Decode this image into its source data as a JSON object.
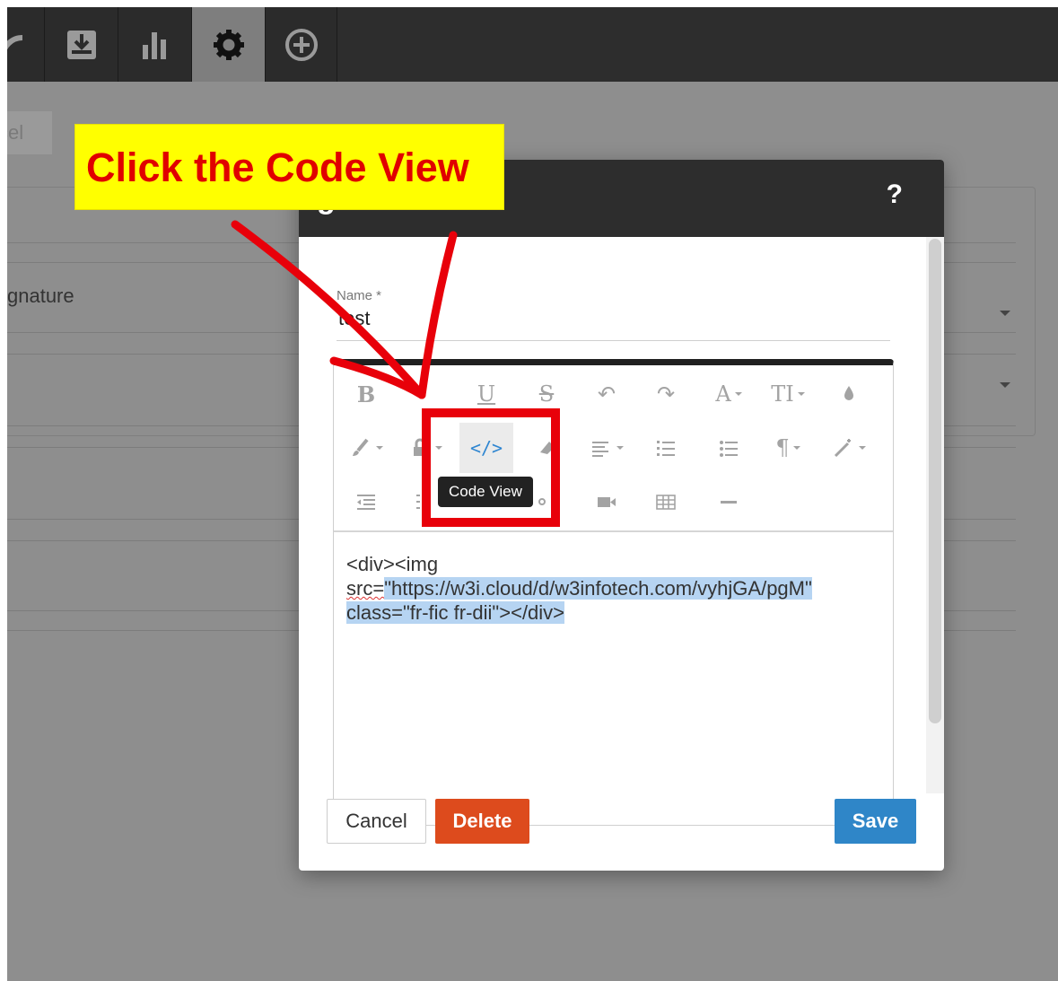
{
  "topbar": {
    "buttons": [
      {
        "icon": "rss-icon",
        "active": false
      },
      {
        "icon": "inbox-download-icon",
        "active": false
      },
      {
        "icon": "bar-chart-icon",
        "active": false
      },
      {
        "icon": "gear-icon",
        "active": true
      },
      {
        "icon": "plus-circle-icon",
        "active": false
      }
    ]
  },
  "background": {
    "button_partial_label": "cel",
    "field_partial_label": "gnature"
  },
  "modal": {
    "title_partial": "g",
    "help_label": "?",
    "name_label": "Name *",
    "name_value": "test",
    "toolbar": {
      "row1": [
        {
          "icon": "bold-icon",
          "glyph": "B"
        },
        {
          "icon": "italic-icon",
          "glyph": ""
        },
        {
          "icon": "underline-icon",
          "glyph": "U"
        },
        {
          "icon": "strikethrough-icon",
          "glyph": "S"
        },
        {
          "icon": "undo-icon",
          "glyph": "↶"
        },
        {
          "icon": "redo-icon",
          "glyph": "↷"
        },
        {
          "icon": "font-family-icon",
          "glyph": "A"
        },
        {
          "icon": "font-size-icon",
          "glyph": "TI"
        },
        {
          "icon": "color-drop-icon",
          "glyph": "💧"
        }
      ],
      "row2": [
        {
          "icon": "paint-brush-icon"
        },
        {
          "icon": "lock-icon"
        },
        {
          "icon": "code-view-icon",
          "glyph": "</>"
        },
        {
          "icon": "eraser-icon"
        },
        {
          "icon": "align-icon"
        },
        {
          "icon": "ordered-list-icon"
        },
        {
          "icon": "unordered-list-icon"
        },
        {
          "icon": "paragraph-icon",
          "glyph": "¶"
        },
        {
          "icon": "magic-wand-icon"
        }
      ],
      "row3": [
        {
          "icon": "outdent-icon"
        },
        {
          "icon": "indent-icon"
        },
        {
          "icon": "link-icon"
        },
        {
          "icon": "image-icon"
        },
        {
          "icon": "video-icon"
        },
        {
          "icon": "table-icon"
        },
        {
          "icon": "horizontal-line-icon"
        }
      ]
    },
    "tooltip": "Code View",
    "code": {
      "line1": "<div><img",
      "line2_prefix": "src=",
      "line2_selected": "\"https://w3i.cloud/d/w3infotech.com/vyhjGA/pgM\"",
      "line3_selected": "class=\"fr-fic fr-dii\"></div>"
    },
    "buttons": {
      "cancel": "Cancel",
      "delete": "Delete",
      "save": "Save"
    }
  },
  "annotation": {
    "callout_text": "Click the Code View",
    "colors": {
      "callout_bg": "#ffff00",
      "callout_text": "#e00000",
      "highlight": "#e8000a"
    }
  },
  "colors": {
    "topbar": "#2d2d2d",
    "delete": "#dd4b1d",
    "save": "#2f86c8",
    "code_view_active": "#2f86d1"
  }
}
